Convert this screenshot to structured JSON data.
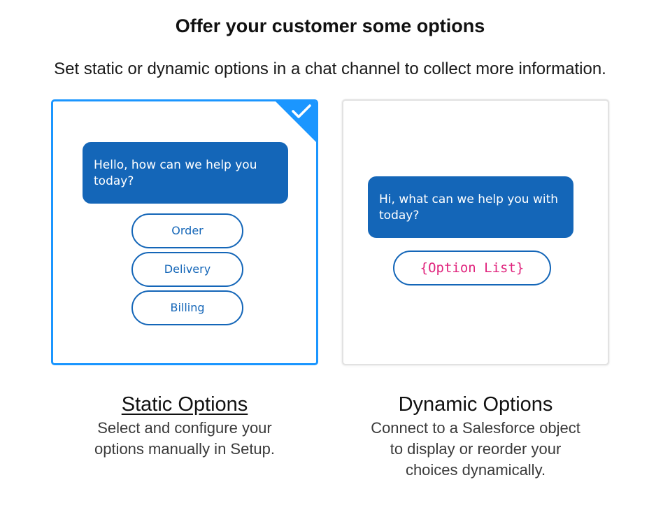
{
  "header": {
    "title": "Offer your customer some options",
    "subtitle": "Set static or dynamic options in a chat channel to collect more information."
  },
  "colors": {
    "selected_border": "#1b96ff",
    "bubble_background": "#1466b8",
    "option_list_text": "#e0247d"
  },
  "static_card": {
    "selected": true,
    "check_icon": "checkmark-icon",
    "bubble_text": "Hello, how can we help you today?",
    "options": [
      "Order",
      "Delivery",
      "Billing"
    ],
    "heading": "Static Options",
    "description": "Select and configure your\noptions manually in Setup."
  },
  "dynamic_card": {
    "selected": false,
    "bubble_text": "Hi, what can we help you with today?",
    "option_placeholder": "{Option List}",
    "heading": "Dynamic Options",
    "description": "Connect to a Salesforce object\nto display or reorder your\nchoices dynamically."
  }
}
